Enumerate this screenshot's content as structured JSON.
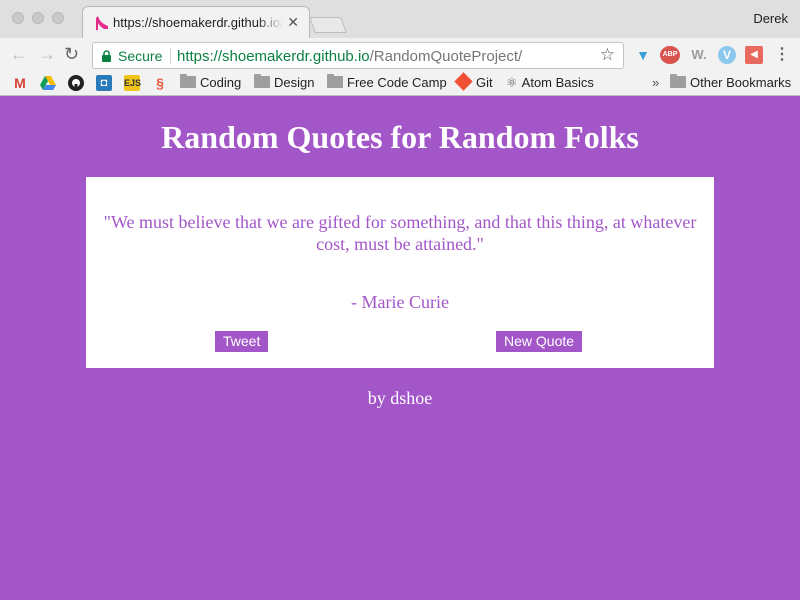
{
  "browser": {
    "tab_title": "https://shoemakerdr.github.io/RandomQuoteProject/",
    "profile_name": "Derek",
    "security_label": "Secure",
    "url_host": "https://shoemakerdr.github.io",
    "url_path": "/RandomQuoteProject/",
    "extensions": [
      {
        "name": "vivaldi-icon",
        "label": "V"
      },
      {
        "name": "adblock-icon",
        "label": "ABP"
      },
      {
        "name": "w-extension-icon",
        "label": "W."
      },
      {
        "name": "vue-devtools-icon",
        "label": "V"
      },
      {
        "name": "speaker-icon",
        "label": "◀"
      }
    ],
    "bookmarks": [
      "Coding",
      "Design",
      "Free Code Camp",
      "Git",
      "Atom Basics"
    ],
    "bookmark_overflow": "»",
    "other_bookmarks": "Other Bookmarks",
    "bookmark_icons": {
      "ejs": "EJS"
    }
  },
  "page": {
    "title": "Random Quotes for Random Folks",
    "quote": "\"We must believe that we are gifted for something, and that this thing, at whatever cost, must be attained.\"",
    "author": "- Marie Curie",
    "tweet_label": "Tweet",
    "new_quote_label": "New Quote",
    "byline": "by dshoe"
  },
  "colors": {
    "brand_purple": "#a356c8",
    "secure_green": "#0b8043"
  }
}
